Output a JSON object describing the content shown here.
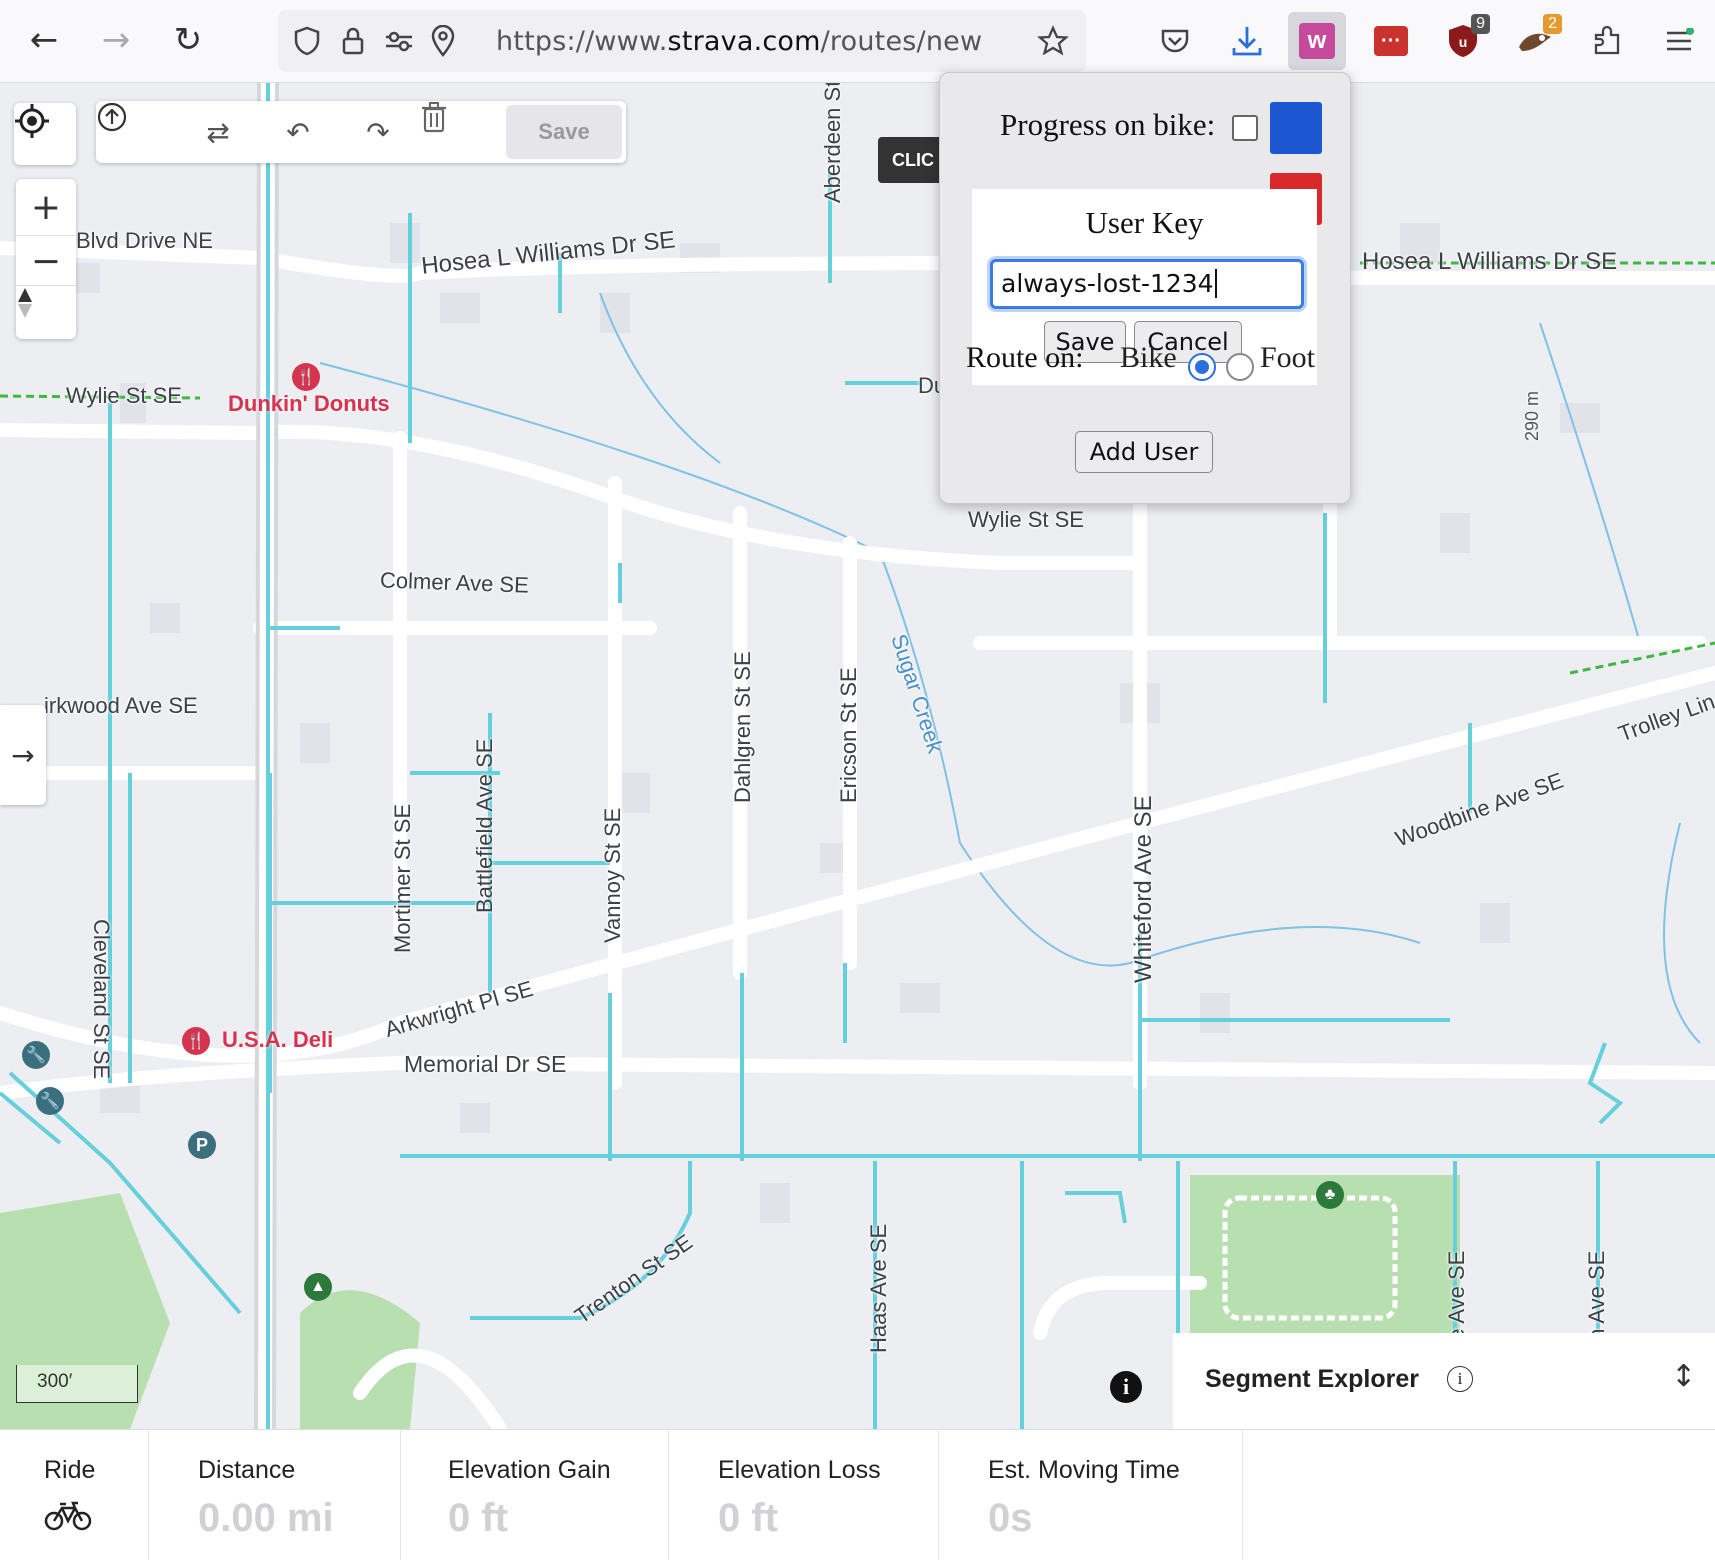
{
  "browser": {
    "url_prefix": "https://www.",
    "url_domain": "strava.com",
    "url_path": "/routes/new",
    "extensions": [
      {
        "name": "extension-w",
        "color": "#c54a9b",
        "label": "w"
      },
      {
        "name": "extension-dots",
        "color": "#c9322f",
        "label": "···"
      },
      {
        "name": "extension-shield",
        "color": "#8b1b1b",
        "badge": "9"
      },
      {
        "name": "extension-bird",
        "color": "#e39a2e",
        "badge": "2"
      }
    ]
  },
  "toolbar": {
    "save_label": "Save",
    "clicked_tooltip": "CLIC"
  },
  "popup": {
    "progress_bike_label": "Progress on bike:",
    "bike_color": "#1c57d1",
    "foot_color": "#d8282a",
    "modal_title": "User Key",
    "key_value": "always-lost-1234",
    "save_label": "Save",
    "cancel_label": "Cancel",
    "route_on_label": "Route on:",
    "route_bike": "Bike",
    "route_foot": "Foot",
    "add_user_label": "Add User"
  },
  "map": {
    "streets": [
      "Blvd Drive NE",
      "Hosea L Williams Dr SE",
      "Hosea L Williams Dr SE",
      "Wylie St SE",
      "Wylie St SE",
      "Colmer Ave SE",
      "irkwood Ave SE",
      "Cleveland St SE",
      "Mortimer St SE",
      "Battlefield Ave SE",
      "Vannoy St SE",
      "Dahlgren St SE",
      "Ericson St SE",
      "Sugar Creek",
      "Whiteford Ave SE",
      "Woodbine Ave SE",
      "Trolley Lin",
      "Arkwright Pl SE",
      "Memorial Dr SE",
      "Trenton St SE",
      "Haas Ave SE",
      "Aberdeen St",
      "de Ave SE",
      "on Ave SE",
      "290 m",
      "Du"
    ],
    "pois": [
      "Dunkin' Donuts",
      "U.S.A. Deli"
    ],
    "scale_label": "300′"
  },
  "segment_explorer": {
    "title": "Segment Explorer"
  },
  "stats": {
    "activity_label": "Ride",
    "distance_label": "Distance",
    "distance_value": "0.00 mi",
    "gain_label": "Elevation Gain",
    "gain_value": "0 ft",
    "loss_label": "Elevation Loss",
    "loss_value": "0 ft",
    "time_label": "Est. Moving Time",
    "time_value": "0s"
  }
}
